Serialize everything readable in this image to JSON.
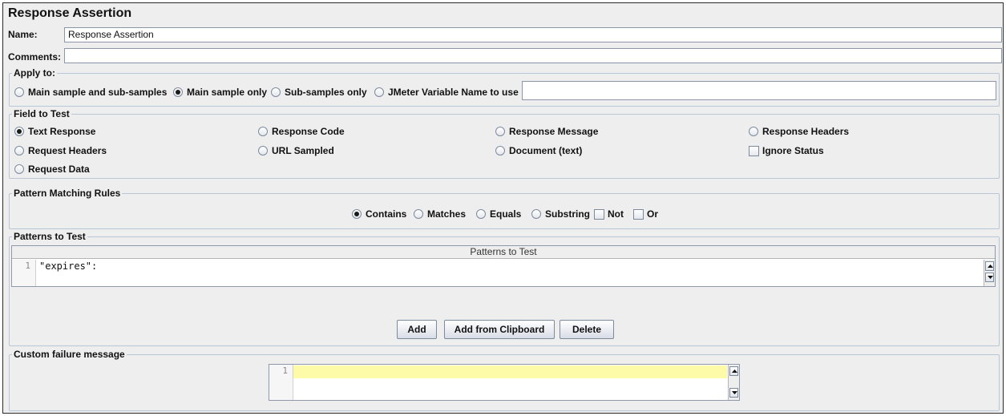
{
  "window": {
    "title": "Response Assertion"
  },
  "name": {
    "label": "Name:",
    "value": "Response Assertion"
  },
  "comments": {
    "label": "Comments:",
    "value": ""
  },
  "apply_to": {
    "legend": "Apply to:",
    "options": [
      {
        "label": "Main sample and sub-samples",
        "selected": false
      },
      {
        "label": "Main sample only",
        "selected": true
      },
      {
        "label": "Sub-samples only",
        "selected": false
      },
      {
        "label": "JMeter Variable Name to use",
        "selected": false
      }
    ],
    "variable_value": ""
  },
  "field_to_test": {
    "legend": "Field to Test",
    "options": [
      {
        "label": "Text Response",
        "selected": true
      },
      {
        "label": "Response Code",
        "selected": false
      },
      {
        "label": "Response Message",
        "selected": false
      },
      {
        "label": "Response Headers",
        "selected": false
      },
      {
        "label": "Request Headers",
        "selected": false
      },
      {
        "label": "URL Sampled",
        "selected": false
      },
      {
        "label": "Document (text)",
        "selected": false
      },
      {
        "label": "Request Data",
        "selected": false
      }
    ],
    "ignore_status": {
      "label": "Ignore Status",
      "checked": false
    }
  },
  "pattern_rules": {
    "legend": "Pattern Matching Rules",
    "options": [
      {
        "label": "Contains",
        "selected": true
      },
      {
        "label": "Matches",
        "selected": false
      },
      {
        "label": "Equals",
        "selected": false
      },
      {
        "label": "Substring",
        "selected": false
      }
    ],
    "checks": [
      {
        "label": "Not",
        "checked": false
      },
      {
        "label": "Or",
        "checked": false
      }
    ]
  },
  "patterns": {
    "legend": "Patterns to Test",
    "column_header": "Patterns to Test",
    "rows": [
      {
        "line": "1",
        "text": "\"expires\":"
      }
    ],
    "buttons": {
      "add": "Add",
      "add_clipboard": "Add from Clipboard",
      "delete": "Delete"
    }
  },
  "failure": {
    "legend": "Custom failure message",
    "line": "1",
    "text": ""
  },
  "colors": {
    "highlight_line": "#fdfaa8",
    "panel_bg": "#eeeeee",
    "border": "#b8c6d6"
  }
}
